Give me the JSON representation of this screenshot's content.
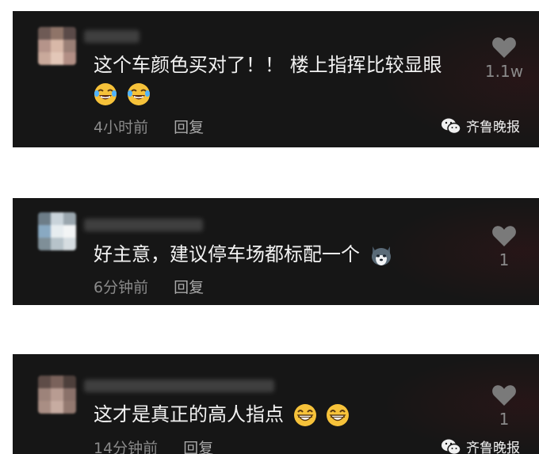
{
  "comments": [
    {
      "text": "这个车颜色买对了！！ 楼上指挥比较显眼",
      "emojis": [
        "laugh-cry-emoji",
        "laugh-cry-emoji"
      ],
      "time": "4小时前",
      "reply_label": "回复",
      "likes": "1.1w",
      "watermark": "齐鲁晚报"
    },
    {
      "text": "好主意，建议停车场都标配一个",
      "emojis": [
        "husky-dog-emoji"
      ],
      "time": "6分钟前",
      "reply_label": "回复",
      "likes": "1"
    },
    {
      "text": "这才是真正的高人指点",
      "emojis": [
        "grin-emoji",
        "grin-emoji"
      ],
      "time": "14分钟前",
      "reply_label": "回复",
      "likes": "1",
      "watermark": "齐鲁晚报"
    }
  ],
  "colors": {
    "card_bg": "#161616",
    "text": "#f2f2f2",
    "meta": "#8a8a8a",
    "heart": "#7a7a7a"
  }
}
